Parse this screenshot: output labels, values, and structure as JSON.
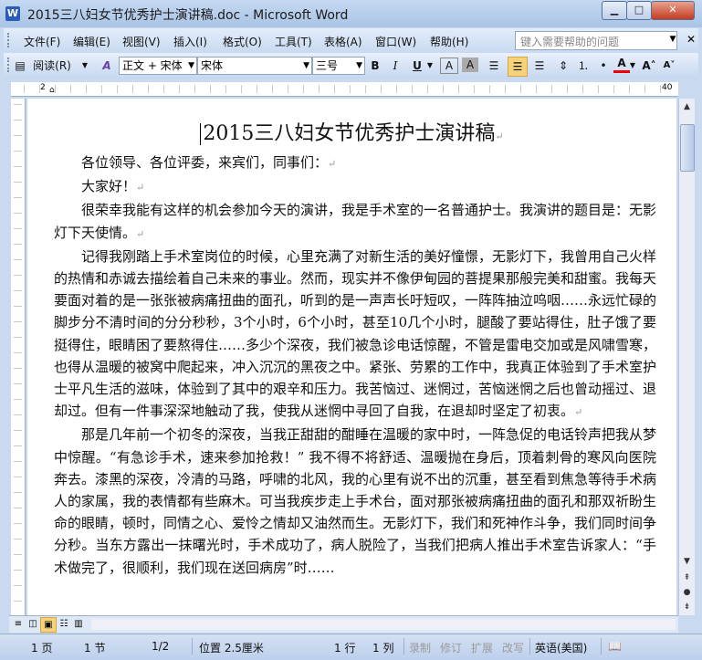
{
  "window": {
    "title": "2015三八妇女节优秀护士演讲稿.doc - Microsoft Word",
    "app_icon": "W",
    "buttons": {
      "minimize": "▁",
      "maximize": "□",
      "close": "✕"
    }
  },
  "menu": {
    "items": [
      "文件(F)",
      "编辑(E)",
      "视图(V)",
      "插入(I)",
      "格式(O)",
      "工具(T)",
      "表格(A)",
      "窗口(W)",
      "帮助(H)"
    ],
    "help_placeholder": "键入需要帮助的问题",
    "close_doc": "✕"
  },
  "toolbar": {
    "read_button": "阅读(R)",
    "style_value": "正文 + 宋体",
    "font_value": "宋体",
    "size_value": "三号",
    "bold": "B",
    "italic": "I",
    "underline": "U"
  },
  "document": {
    "title": "2015三八妇女节优秀护士演讲稿",
    "paragraphs": [
      "各位领导、各位评委，来宾们，同事们：",
      "大家好！",
      "很荣幸我能有这样的机会参加今天的演讲，我是手术室的一名普通护士。我演讲的题目是：无影灯下天使情。",
      "记得我刚踏上手术室岗位的时候，心里充满了对新生活的美好憧憬，无影灯下，我曾用自己火样的热情和赤诚去描绘着自己未来的事业。然而，现实并不像伊甸园的菩提果那般完美和甜蜜。我每天要面对着的是一张张被病痛扭曲的面孔，听到的是一声声长吁短叹，一阵阵抽泣呜咽……永远忙碌的脚步分不清时间的分分秒秒，3个小时，6个小时，甚至10几个小时，腿酸了要站得住，肚子饿了要挺得住，眼睛困了要熬得住……多少个深夜，我们被急诊电话惊醒，不管是雷电交加或是风啸雪寒，也得从温暖的被窝中爬起来，冲入沉沉的黑夜之中。紧张、劳累的工作中，我真正体验到了手术室护士平凡生活的滋味，体验到了其中的艰辛和压力。我苦恼过、迷惘过，苦恼迷惘之后也曾动摇过、退却过。但有一件事深深地触动了我，使我从迷惘中寻回了自我，在退却时坚定了初衷。",
      "那是几年前一个初冬的深夜，当我正甜甜的酣睡在温暖的家中时，一阵急促的电话铃声把我从梦中惊醒。“有急诊手术，速来参加抢救！” 我不得不将舒适、温暖抛在身后，顶着刺骨的寒风向医院奔去。漆黑的深夜，冷清的马路，呼啸的北风，我的心里有说不出的沉重，甚至看到焦急等待手术病人的家属，我的表情都有些麻木。可当我疾步走上手术台，面对那张被病痛扭曲的面孔和那双祈盼生命的眼睛，顿时，同情之心、爱怜之情却又油然而生。无影灯下，我们和死神作斗争，我们同时间争分秒。当东方露出一抹曙光时，手术成功了，病人脱险了，当我们把病人推出手术室告诉家人：“手术做完了，很顺利，我们现在送回病房”时……"
    ]
  },
  "status": {
    "page": "1 页",
    "section": "1 节",
    "page_of": "1/2",
    "position": "位置 2.5厘米",
    "line": "1 行",
    "column": "1 列",
    "rec": "录制",
    "trk": "修订",
    "ext": "扩展",
    "ovr": "改写",
    "language": "英语(美国)"
  },
  "ruler": {
    "left_num": "2",
    "right_num": "40"
  },
  "colors": {
    "accent": "#2b5cb8",
    "chrome": "#c9daf0"
  }
}
